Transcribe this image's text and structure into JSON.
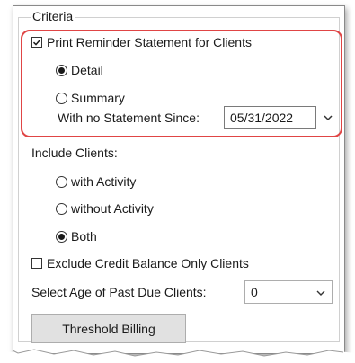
{
  "group_title": "Criteria",
  "print_reminder": {
    "label": "Print Reminder Statement for Clients",
    "checked": true,
    "detail_label": "Detail",
    "summary_label": "Summary",
    "selected": "Detail",
    "no_statement_label": "With no Statement Since:",
    "date_value": "05/31/2022"
  },
  "include_clients": {
    "label": "Include Clients:",
    "options": [
      "with Activity",
      "without Activity",
      "Both"
    ],
    "selected": "Both"
  },
  "exclude_credit": {
    "label": "Exclude Credit Balance Only Clients",
    "checked": false
  },
  "age_past_due": {
    "label": "Select Age of Past Due Clients:",
    "value": "0"
  },
  "threshold_button": "Threshold Billing",
  "colors": {
    "highlight": "#e04545",
    "button_bg": "#e1e1e1"
  },
  "icons": {
    "checkbox_checked": "check-icon",
    "dropdown": "chevron-down-icon"
  }
}
